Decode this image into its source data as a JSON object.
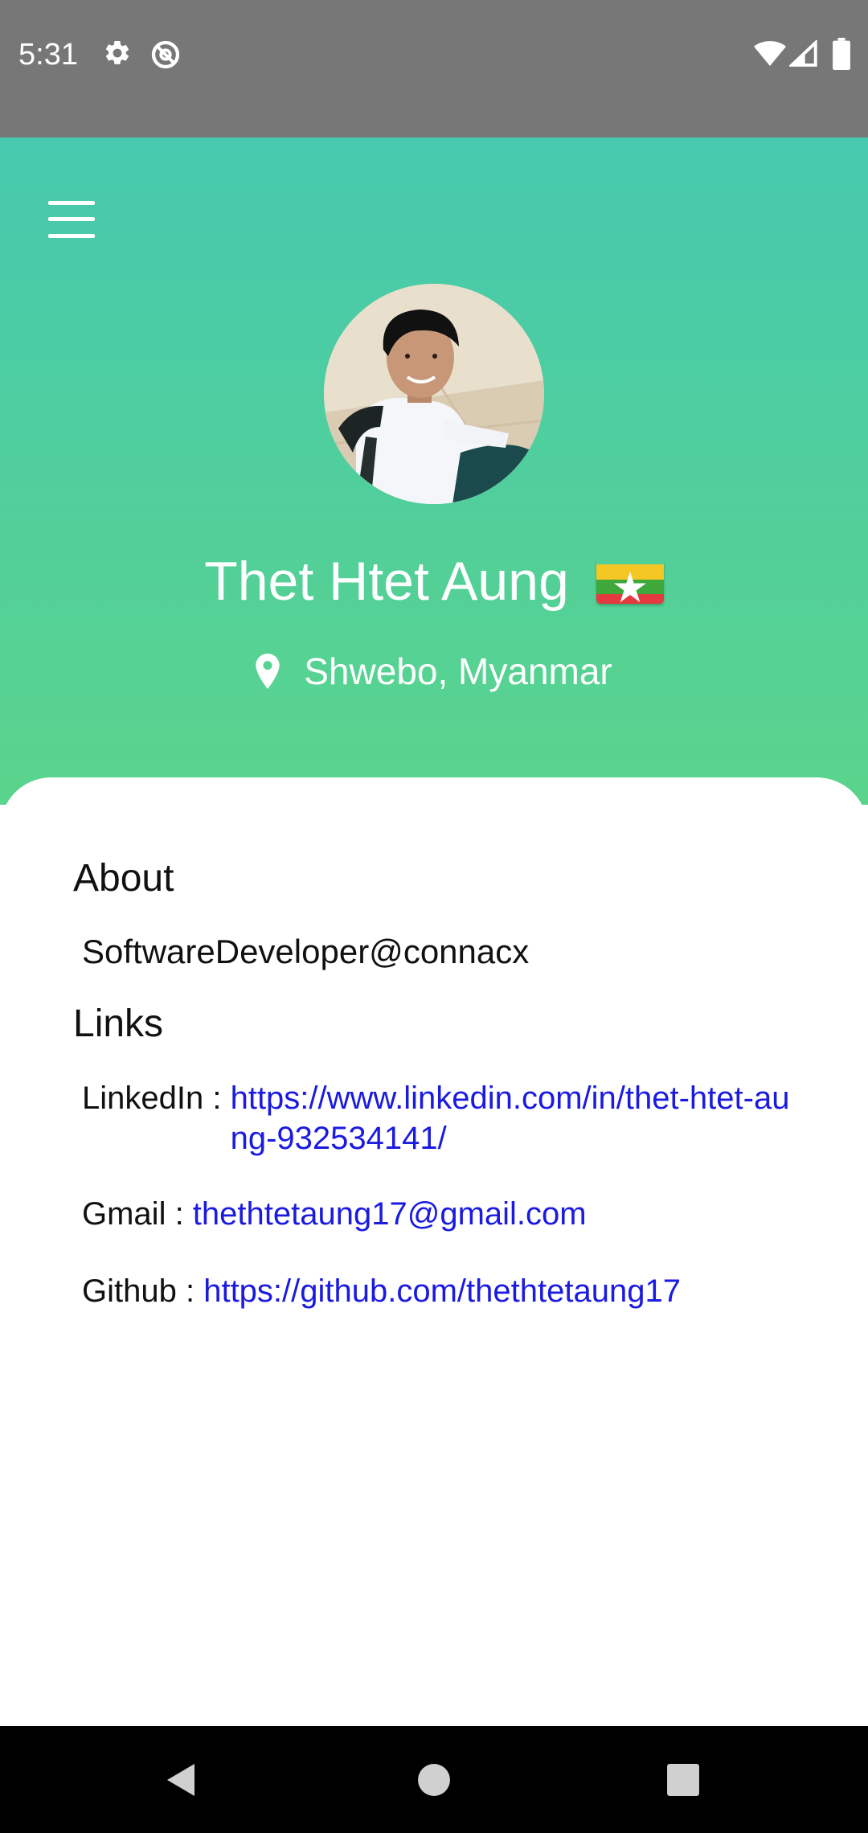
{
  "status_bar": {
    "time": "5:31",
    "left_icons": [
      "settings-icon",
      "do-not-disturb-icon"
    ],
    "right_icons": [
      "wifi-icon",
      "cell-signal-icon",
      "battery-icon"
    ]
  },
  "header": {
    "menu_icon": "hamburger-menu-icon",
    "name": "Thet Htet Aung",
    "flag": "myanmar-flag",
    "location": "Shwebo, Myanmar",
    "location_icon": "location-pin-icon",
    "gradient": [
      "#46c9ae",
      "#5ad48c"
    ]
  },
  "about": {
    "title": "About",
    "text": "SoftwareDeveloper@connacx"
  },
  "links": {
    "title": "Links",
    "items": [
      {
        "label": "LinkedIn : ",
        "value": "https://www.linkedin.com/in/thet-htet-aung-932534141/"
      },
      {
        "label": "Gmail : ",
        "value": "thethtetaung17@gmail.com"
      },
      {
        "label": "Github : ",
        "value": "https://github.com/thethtetaung17"
      }
    ]
  },
  "colors": {
    "link": "#1a1ae0",
    "status_bar": "#777777",
    "nav_bar": "#000000"
  },
  "nav_bar": {
    "buttons": [
      "back-icon",
      "home-icon",
      "recents-icon"
    ]
  }
}
